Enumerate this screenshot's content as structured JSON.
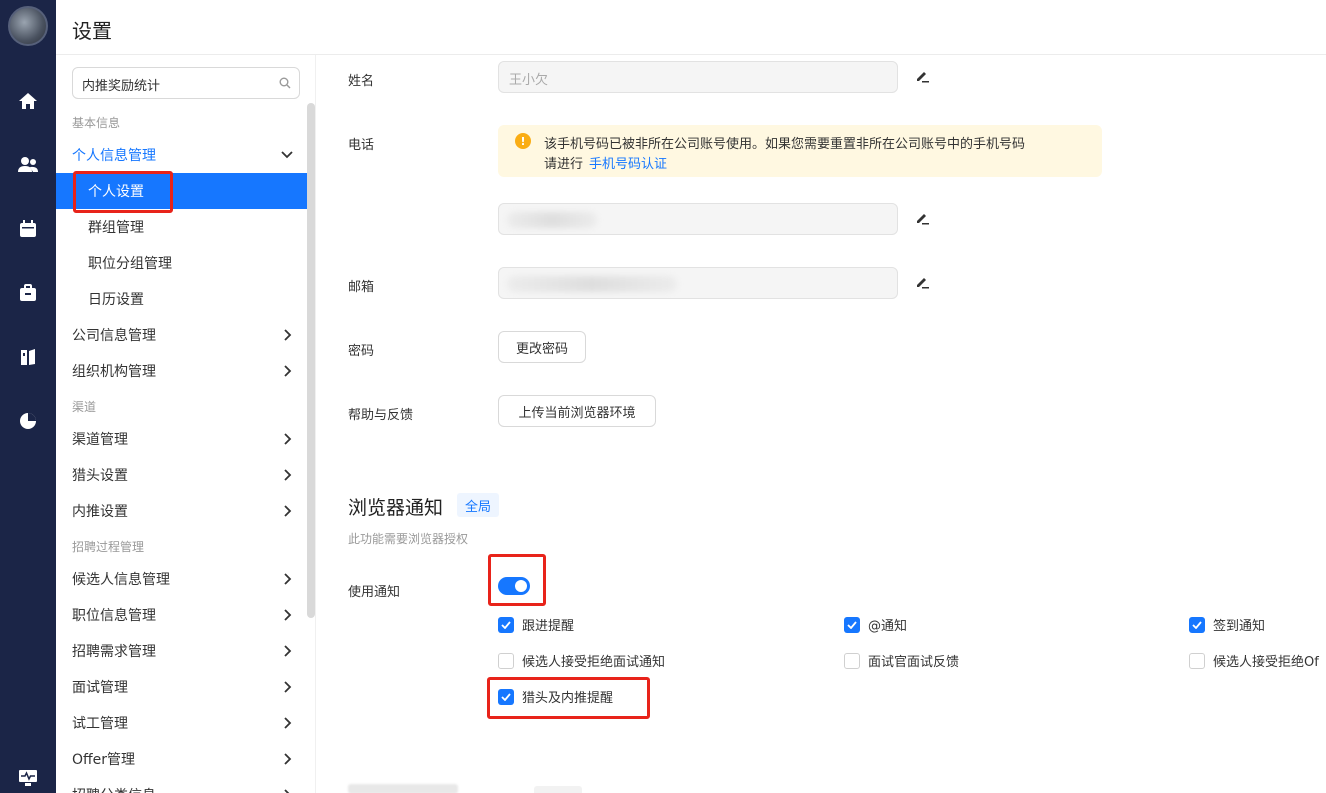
{
  "app": {
    "page_title": "设置"
  },
  "rail": {
    "icons": [
      "home-icon",
      "users-icon",
      "calendar-icon",
      "briefcase-icon",
      "book-icon",
      "pie-chart-icon",
      "monitor-icon"
    ]
  },
  "sidebar": {
    "search_value": "内推奖励统计",
    "groups": [
      {
        "title": "基本信息"
      },
      {
        "title": "渠道"
      },
      {
        "title": "招聘过程管理"
      }
    ],
    "items": [
      {
        "label": "个人信息管理"
      },
      {
        "label": "个人设置"
      },
      {
        "label": "群组管理"
      },
      {
        "label": "职位分组管理"
      },
      {
        "label": "日历设置"
      },
      {
        "label": "公司信息管理"
      },
      {
        "label": "组织机构管理"
      },
      {
        "label": "渠道管理"
      },
      {
        "label": "猎头设置"
      },
      {
        "label": "内推设置"
      },
      {
        "label": "候选人信息管理"
      },
      {
        "label": "职位信息管理"
      },
      {
        "label": "招聘需求管理"
      },
      {
        "label": "面试管理"
      },
      {
        "label": "试工管理"
      },
      {
        "label": "Offer管理"
      },
      {
        "label": "招聘分类信息"
      }
    ]
  },
  "profile": {
    "name_label": "姓名",
    "name_value": "王小欠",
    "phone_label": "电话",
    "warning_line1": "该手机号码已被非所在公司账号使用。如果您需要重置非所在公司账号中的手机号码",
    "warning_line2": "请进行",
    "warning_link": "手机号码认证",
    "email_label": "邮箱",
    "password_label": "密码",
    "change_password_button": "更改密码",
    "help_label": "帮助与反馈",
    "upload_env_button": "上传当前浏览器环境"
  },
  "notifications": {
    "section_title": "浏览器通知",
    "scope_tag": "全局",
    "description": "此功能需要浏览器授权",
    "use_label": "使用通知",
    "toggle_on": true,
    "options": [
      {
        "label": "跟进提醒",
        "checked": true
      },
      {
        "label": "@通知",
        "checked": true
      },
      {
        "label": "签到通知",
        "checked": true
      },
      {
        "label": "候选人接受拒绝面试通知",
        "checked": false
      },
      {
        "label": "面试官面试反馈",
        "checked": false
      },
      {
        "label": "候选人接受拒绝Of",
        "checked": false
      },
      {
        "label": "猎头及内推提醒",
        "checked": true
      }
    ]
  },
  "colors": {
    "primary": "#1677ff",
    "rail": "#1b2547",
    "highlight": "#e8231a",
    "warning_bg": "#fff8e1"
  }
}
